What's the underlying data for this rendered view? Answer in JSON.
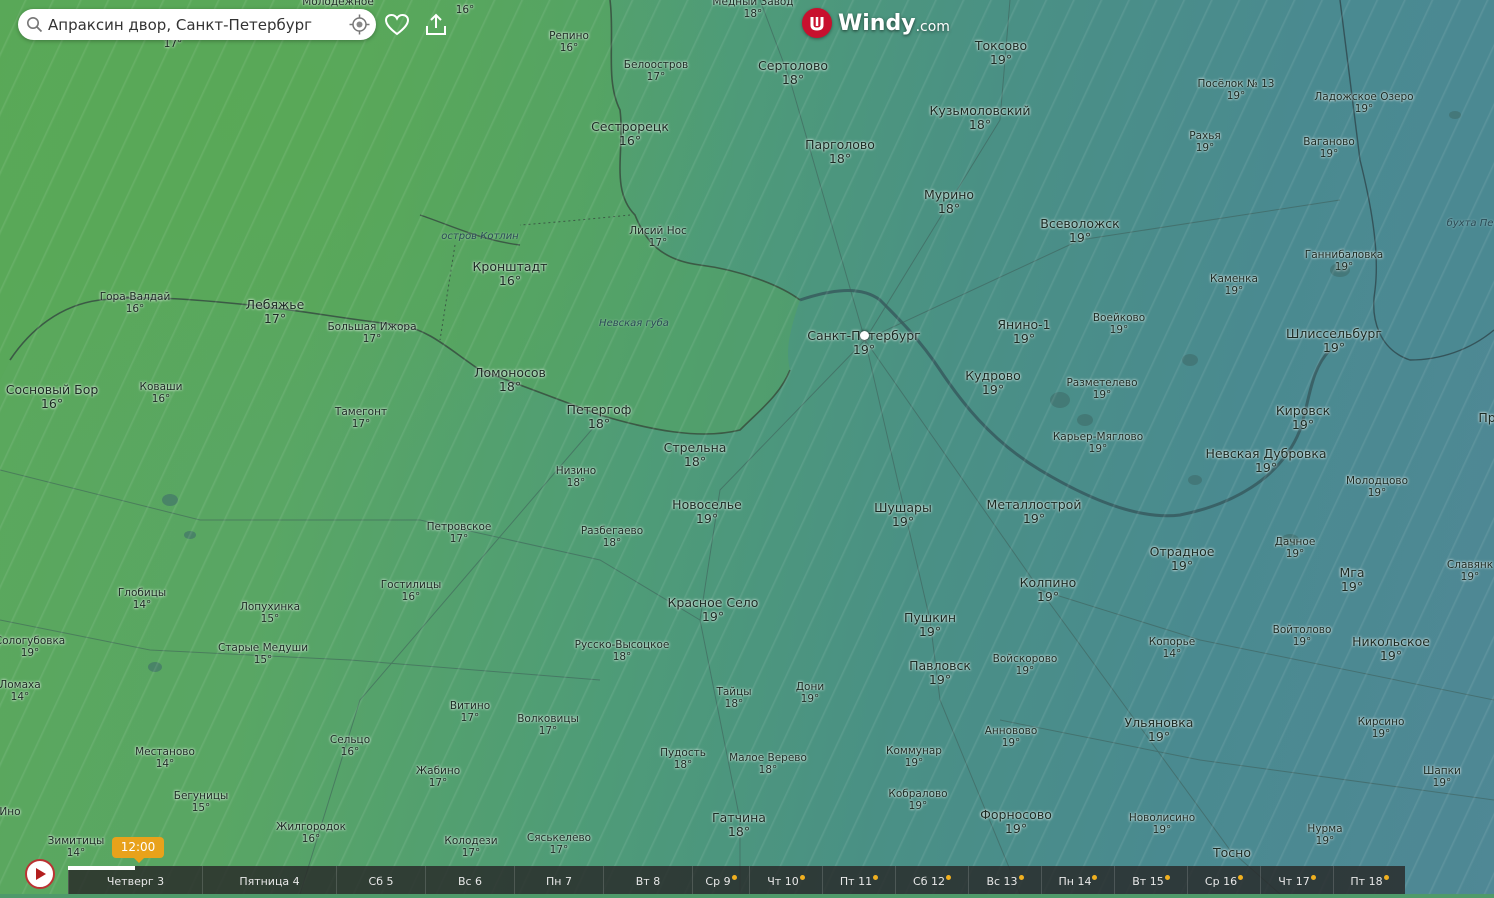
{
  "search": {
    "value": "Апраксин двор, Санкт-Петербург"
  },
  "logo": {
    "word": "Windy",
    "domain": ".com"
  },
  "water_labels": [
    {
      "text": "Невская губа"
    },
    {
      "text": "остров Котлин"
    },
    {
      "text": "бухта Пе"
    }
  ],
  "cities": [
    {
      "name": "Молодёжное",
      "temp": "",
      "size": "sm"
    },
    {
      "name": "",
      "temp": "16°",
      "size": "sm"
    },
    {
      "name": "Медный Завод",
      "temp": "18°",
      "size": "sm"
    },
    {
      "name": "",
      "temp": "17°",
      "size": "sm"
    },
    {
      "name": "Репино",
      "temp": "16°",
      "size": "sm"
    },
    {
      "name": "Белоостров",
      "temp": "17°",
      "size": "sm"
    },
    {
      "name": "Сертолово",
      "temp": "18°",
      "size": "big"
    },
    {
      "name": "Токсово",
      "temp": "19°",
      "size": "big"
    },
    {
      "name": "Посёлок № 13",
      "temp": "19°",
      "size": "sm"
    },
    {
      "name": "Ладожское Озеро",
      "temp": "19°",
      "size": "sm"
    },
    {
      "name": "Кузьмоловский",
      "temp": "18°",
      "size": "big"
    },
    {
      "name": "Сестрорецк",
      "temp": "16°",
      "size": "big"
    },
    {
      "name": "Рахья",
      "temp": "19°",
      "size": "sm"
    },
    {
      "name": "Ваганово",
      "temp": "19°",
      "size": "sm"
    },
    {
      "name": "Парголово",
      "temp": "18°",
      "size": "big"
    },
    {
      "name": "Мурино",
      "temp": "18°",
      "size": "big"
    },
    {
      "name": "Всеволожск",
      "temp": "19°",
      "size": "big"
    },
    {
      "name": "Лисий Нос",
      "temp": "17°",
      "size": "sm"
    },
    {
      "name": "Ганнибаловка",
      "temp": "19°",
      "size": "sm"
    },
    {
      "name": "Кронштадт",
      "temp": "16°",
      "size": "big"
    },
    {
      "name": "Каменка",
      "temp": "19°",
      "size": "sm"
    },
    {
      "name": "Гора-Валдай",
      "temp": "16°",
      "size": "sm"
    },
    {
      "name": "Лебяжье",
      "temp": "17°",
      "size": "big"
    },
    {
      "name": "Большая Ижора",
      "temp": "17°",
      "size": "sm"
    },
    {
      "name": "Воейково",
      "temp": "19°",
      "size": "sm"
    },
    {
      "name": "Янино-1",
      "temp": "19°",
      "size": "big"
    },
    {
      "name": "Шлиссельбург",
      "temp": "19°",
      "size": "big"
    },
    {
      "name": "Санкт-Петербург",
      "temp": "19°",
      "size": "big"
    },
    {
      "name": "Ломоносов",
      "temp": "18°",
      "size": "big"
    },
    {
      "name": "Кудрово",
      "temp": "19°",
      "size": "big"
    },
    {
      "name": "Разметелево",
      "temp": "19°",
      "size": "sm"
    },
    {
      "name": "Сосновый Бор",
      "temp": "16°",
      "size": "big"
    },
    {
      "name": "Коваши",
      "temp": "16°",
      "size": "sm"
    },
    {
      "name": "Петергоф",
      "temp": "18°",
      "size": "big"
    },
    {
      "name": "Тамегонт",
      "temp": "17°",
      "size": "sm"
    },
    {
      "name": "Кировск",
      "temp": "19°",
      "size": "big"
    },
    {
      "name": "Пр",
      "temp": "",
      "size": "big"
    },
    {
      "name": "Карьер-Мяглово",
      "temp": "19°",
      "size": "sm"
    },
    {
      "name": "Стрельна",
      "temp": "18°",
      "size": "big"
    },
    {
      "name": "Невская Дубровка",
      "temp": "19°",
      "size": "big"
    },
    {
      "name": "Низино",
      "temp": "18°",
      "size": "sm"
    },
    {
      "name": "Молодцово",
      "temp": "19°",
      "size": "sm"
    },
    {
      "name": "Новоселье",
      "temp": "19°",
      "size": "big"
    },
    {
      "name": "Шушары",
      "temp": "19°",
      "size": "big"
    },
    {
      "name": "Металлострой",
      "temp": "19°",
      "size": "big"
    },
    {
      "name": "Петровское",
      "temp": "17°",
      "size": "sm"
    },
    {
      "name": "Разбегаево",
      "temp": "18°",
      "size": "sm"
    },
    {
      "name": "Дачное",
      "temp": "19°",
      "size": "sm"
    },
    {
      "name": "Отрадное",
      "temp": "19°",
      "size": "big"
    },
    {
      "name": "Славянк",
      "temp": "19°",
      "size": "sm"
    },
    {
      "name": "Мга",
      "temp": "19°",
      "size": "big"
    },
    {
      "name": "Колпино",
      "temp": "19°",
      "size": "big"
    },
    {
      "name": "Гостилицы",
      "temp": "16°",
      "size": "sm"
    },
    {
      "name": "Глобицы",
      "temp": "14°",
      "size": "sm"
    },
    {
      "name": "Красное Село",
      "temp": "19°",
      "size": "big"
    },
    {
      "name": "Лопухинка",
      "temp": "15°",
      "size": "sm"
    },
    {
      "name": "Пушкин",
      "temp": "19°",
      "size": "big"
    },
    {
      "name": "Войтолово",
      "temp": "19°",
      "size": "sm"
    },
    {
      "name": "Копорье",
      "temp": "14°",
      "size": "sm"
    },
    {
      "name": "Никольское",
      "temp": "19°",
      "size": "big"
    },
    {
      "name": "Сологубовка",
      "temp": "19°",
      "size": "sm"
    },
    {
      "name": "Старые Медуши",
      "temp": "15°",
      "size": "sm"
    },
    {
      "name": "Русско-Высоцкое",
      "temp": "18°",
      "size": "sm"
    },
    {
      "name": "Павловск",
      "temp": "19°",
      "size": "big"
    },
    {
      "name": "Войскорово",
      "temp": "19°",
      "size": "sm"
    },
    {
      "name": "Ломаха",
      "temp": "14°",
      "size": "sm"
    },
    {
      "name": "Дони",
      "temp": "19°",
      "size": "sm"
    },
    {
      "name": "Тайцы",
      "temp": "18°",
      "size": "sm"
    },
    {
      "name": "Витино",
      "temp": "17°",
      "size": "sm"
    },
    {
      "name": "Волковицы",
      "temp": "17°",
      "size": "sm"
    },
    {
      "name": "Ульяновка",
      "temp": "19°",
      "size": "big"
    },
    {
      "name": "Кирсино",
      "temp": "19°",
      "size": "sm"
    },
    {
      "name": "Анновово",
      "temp": "19°",
      "size": "sm"
    },
    {
      "name": "Сельцо",
      "temp": "16°",
      "size": "sm"
    },
    {
      "name": "Местаново",
      "temp": "14°",
      "size": "sm"
    },
    {
      "name": "Пудость",
      "temp": "18°",
      "size": "sm"
    },
    {
      "name": "Коммунар",
      "temp": "19°",
      "size": "sm"
    },
    {
      "name": "Малое Верево",
      "temp": "18°",
      "size": "sm"
    },
    {
      "name": "Жабино",
      "temp": "17°",
      "size": "sm"
    },
    {
      "name": "Шапки",
      "temp": "19°",
      "size": "sm"
    },
    {
      "name": "Бегуницы",
      "temp": "15°",
      "size": "sm"
    },
    {
      "name": "Кобралово",
      "temp": "19°",
      "size": "sm"
    },
    {
      "name": "Гатчина",
      "temp": "18°",
      "size": "big"
    },
    {
      "name": "Форносово",
      "temp": "19°",
      "size": "big"
    },
    {
      "name": "Новолисино",
      "temp": "19°",
      "size": "sm"
    },
    {
      "name": "Жилгородок",
      "temp": "16°",
      "size": "sm"
    },
    {
      "name": "Нурма",
      "temp": "19°",
      "size": "sm"
    },
    {
      "name": "Зимитицы",
      "temp": "14°",
      "size": "sm"
    },
    {
      "name": "Колодези",
      "temp": "17°",
      "size": "sm"
    },
    {
      "name": "Сяськелево",
      "temp": "17°",
      "size": "sm"
    },
    {
      "name": "Тосно",
      "temp": "",
      "size": "big"
    },
    {
      "name": "Ино",
      "temp": "",
      "size": "sm"
    }
  ],
  "timeline": {
    "current_time": "12:00",
    "progress": 0.05,
    "days": [
      {
        "label": "Четверг 3",
        "sun": false
      },
      {
        "label": "Пятница 4",
        "sun": false
      },
      {
        "label": "Сб 5",
        "sun": false
      },
      {
        "label": "Вс 6",
        "sun": false
      },
      {
        "label": "Пн 7",
        "sun": false
      },
      {
        "label": "Вт 8",
        "sun": false
      },
      {
        "label": "Ср 9",
        "sun": true
      },
      {
        "label": "Чт 10",
        "sun": true
      },
      {
        "label": "Пт 11",
        "sun": true
      },
      {
        "label": "Сб 12",
        "sun": true
      },
      {
        "label": "Вс 13",
        "sun": true
      },
      {
        "label": "Пн 14",
        "sun": true
      },
      {
        "label": "Вт 15",
        "sun": true
      },
      {
        "label": "Ср 16",
        "sun": true
      },
      {
        "label": "Чт 17",
        "sun": true
      },
      {
        "label": "Пт 18",
        "sun": true
      }
    ]
  },
  "colors": {
    "accent": "#e8a21b",
    "logo": "#c8102e"
  }
}
